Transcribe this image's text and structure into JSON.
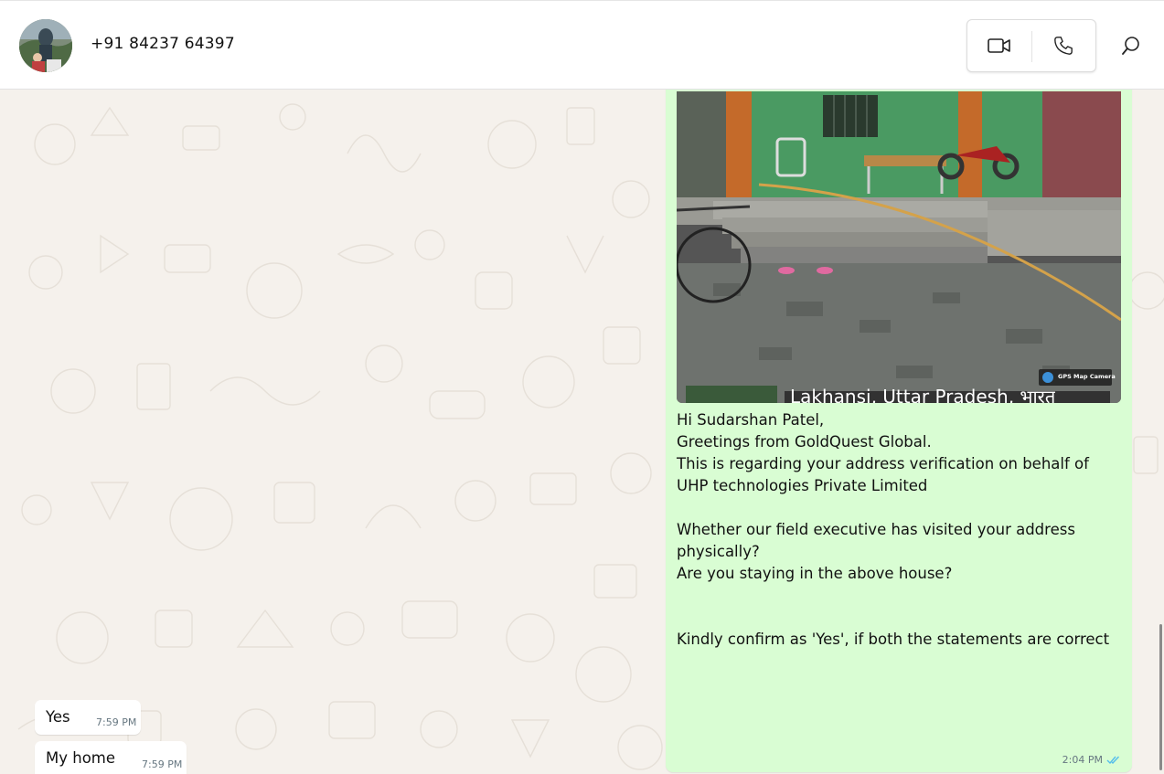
{
  "header": {
    "contact_name": "+91 84237 64397",
    "avatar_icon": "contact-avatar",
    "video_call_icon": "video-camera-icon",
    "voice_call_icon": "phone-icon",
    "search_icon": "search-icon"
  },
  "messages": [
    {
      "direction": "outgoing",
      "type": "image-with-caption",
      "image_overlay": {
        "badge": "GPS Map Camera",
        "location": "Lakhansi, Uttar Pradesh, भारत"
      },
      "text": "Hi Sudarshan Patel,\nGreetings from GoldQuest Global.\nThis is regarding your address verification on behalf of\nUHP technologies Private Limited\n\nWhether our field executive has visited your address\nphysically?\nAre you staying in the above house?\n\n\nKindly confirm as 'Yes', if both the statements are correct",
      "time": "2:04 PM",
      "status": "read"
    },
    {
      "direction": "incoming",
      "text": "Yes",
      "time": "7:59 PM"
    },
    {
      "direction": "incoming",
      "text": "My home",
      "time": "7:59 PM"
    }
  ],
  "colors": {
    "outgoing_bubble": "#d9fdd3",
    "incoming_bubble": "#ffffff",
    "read_ticks": "#53bdeb",
    "wallpaper": "#f5f1ec"
  }
}
